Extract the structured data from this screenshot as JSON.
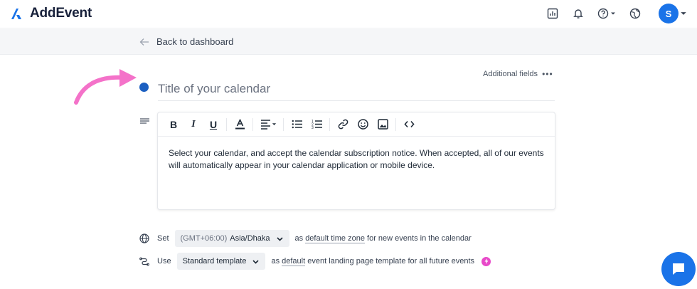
{
  "brand": {
    "name": "AddEvent",
    "color": "#1a73e8"
  },
  "topbar": {
    "icons": [
      "analytics-icon",
      "bell-icon",
      "help-icon",
      "globe-icon"
    ],
    "avatar_initial": "S"
  },
  "subbar": {
    "back_label": "Back to dashboard"
  },
  "form": {
    "additional_fields": "Additional fields",
    "title_placeholder": "Title of your calendar",
    "title_value": "",
    "calendar_color": "#1b5fc1",
    "description": "Select your calendar, and accept the calendar subscription notice. When accepted, all of our events will automatically appear in your calendar application or mobile device."
  },
  "editor_toolbar": [
    "bold",
    "italic",
    "underline",
    "font-color",
    "align",
    "bulleted-list",
    "numbered-list",
    "link",
    "emoji",
    "image",
    "code"
  ],
  "timezone_row": {
    "prefix": "Set",
    "offset": "(GMT+06:00)",
    "zone": "Asia/Dhaka",
    "middle": "as",
    "link": "default time zone",
    "suffix": "for new events in the calendar"
  },
  "template_row": {
    "prefix": "Use",
    "template": "Standard template",
    "middle": "as",
    "link": "default",
    "suffix": "event landing page template for all future events"
  },
  "accent_colors": {
    "arrow": "#f472c9",
    "bolt": "#e849c9"
  }
}
